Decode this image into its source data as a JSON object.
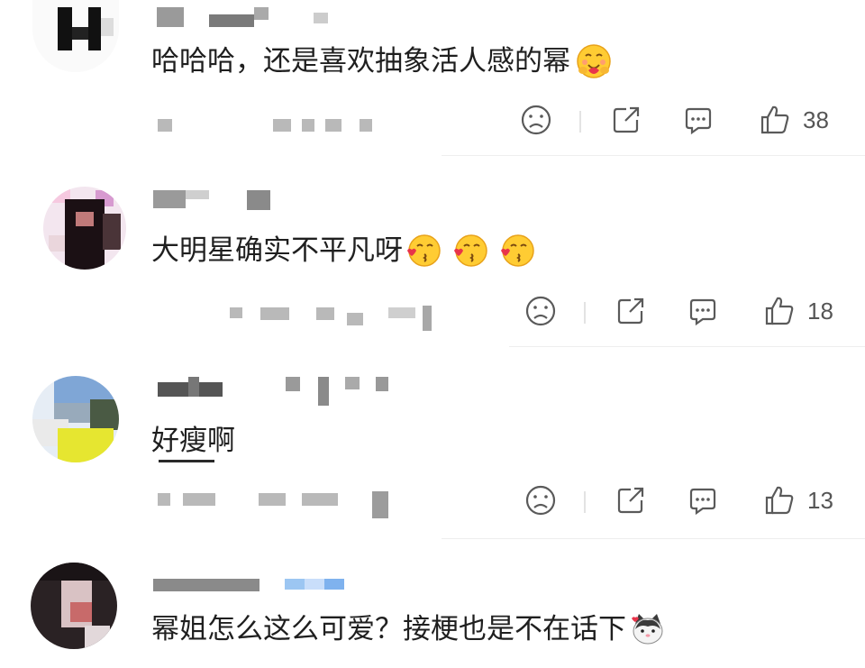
{
  "comments": [
    {
      "text": "哈哈哈，还是喜欢抽象活人感的幂",
      "likes": "38",
      "emojis": [
        "hug-face-emoji"
      ]
    },
    {
      "text": "大明星确实不平凡呀",
      "likes": "18",
      "emojis": [
        "kiss-face-emoji",
        "kiss-face-emoji",
        "kiss-face-emoji"
      ]
    },
    {
      "text": "好瘦啊",
      "likes": "13",
      "emojis": []
    },
    {
      "text": "幂姐怎么这么可爱？接梗也是不在话下",
      "likes": "",
      "emojis": [
        "cat-face-emoji"
      ]
    }
  ],
  "actions": {
    "icons": [
      "dislike-icon",
      "share-icon",
      "reply-icon",
      "like-icon"
    ]
  },
  "colors": {
    "text": "#1f1f1f",
    "icon": "#5a5a5a",
    "count": "#555555",
    "divider": "#eeeeee",
    "emoji_yellow": "#ffcc33",
    "heart_red": "#e8344a"
  }
}
